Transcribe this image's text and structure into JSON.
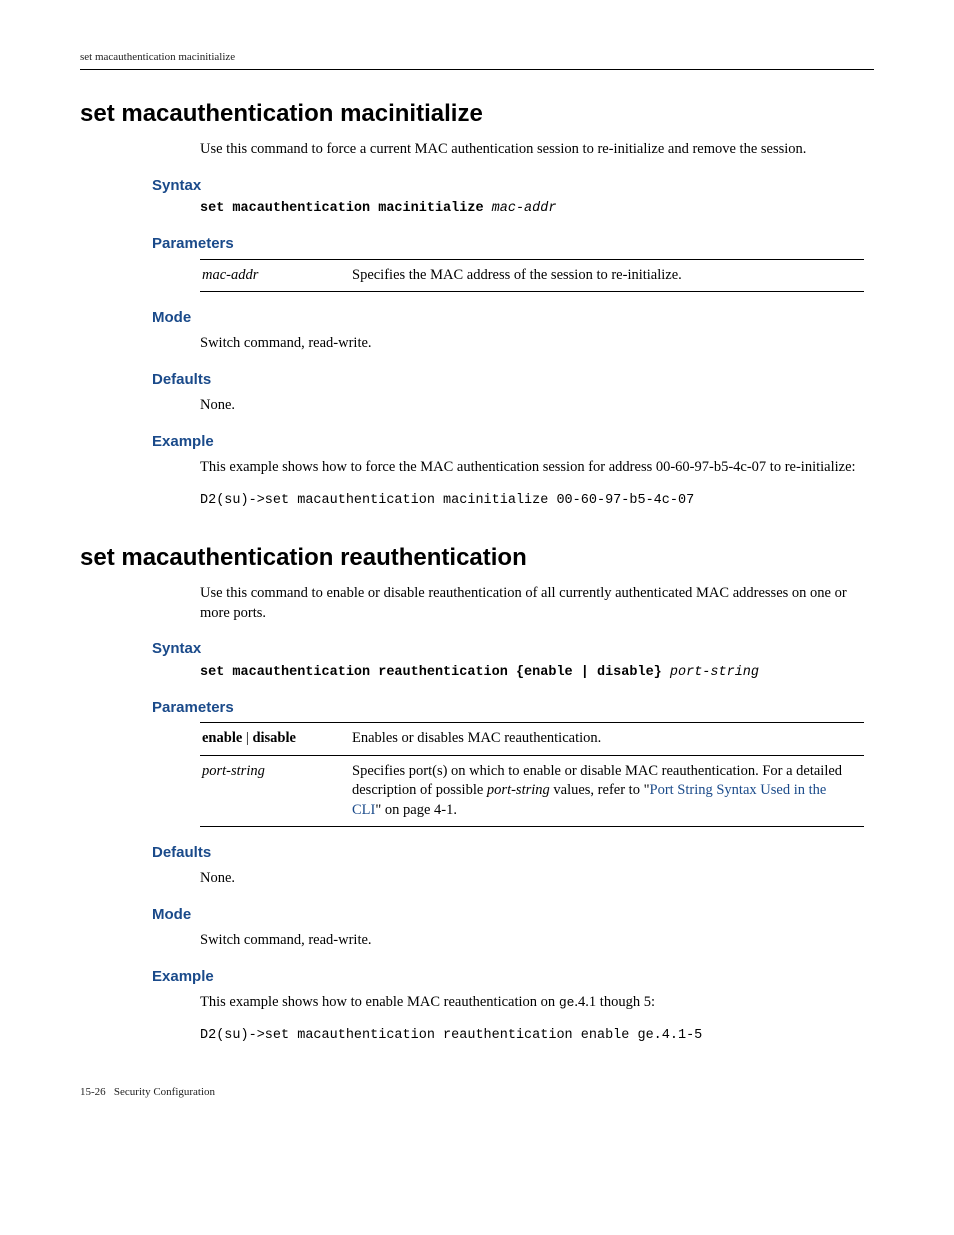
{
  "header": {
    "text": "set macauthentication macinitialize"
  },
  "section1": {
    "title": "set macauthentication macinitialize",
    "intro": "Use this command to force a current MAC authentication session to re-initialize and remove the session.",
    "syntax_label": "Syntax",
    "syntax_cmd": "set macauthentication macinitialize",
    "syntax_arg": "mac-addr",
    "parameters_label": "Parameters",
    "param_name": "mac-addr",
    "param_desc": "Specifies the MAC address of the session to re-initialize.",
    "mode_label": "Mode",
    "mode_text": "Switch command, read-write.",
    "defaults_label": "Defaults",
    "defaults_text": "None.",
    "example_label": "Example",
    "example_intro": "This example shows how to force the MAC authentication session for address 00-60-97-b5-4c-07 to re-initialize:",
    "example_code": "D2(su)->set macauthentication macinitialize 00-60-97-b5-4c-07"
  },
  "section2": {
    "title": "set macauthentication reauthentication",
    "intro": "Use this command to enable or disable reauthentication of all currently authenticated MAC addresses on one or more ports.",
    "syntax_label": "Syntax",
    "syntax_cmd": "set macauthentication reauthentication {enable | disable}",
    "syntax_arg": "port-string",
    "parameters_label": "Parameters",
    "row1_left_a": "enable",
    "row1_left_sep": " | ",
    "row1_left_b": "disable",
    "row1_desc": "Enables or disables MAC reauthentication.",
    "row2_left": "port-string",
    "row2_desc_a": "Specifies port(s) on which to enable or disable MAC reauthentication. For a detailed description of possible ",
    "row2_desc_ital": "port-string",
    "row2_desc_b": " values, refer to \"",
    "row2_link": "Port String Syntax Used in the CLI",
    "row2_desc_c": "\" on page 4-1.",
    "defaults_label": "Defaults",
    "defaults_text": "None.",
    "mode_label": "Mode",
    "mode_text": "Switch command, read-write.",
    "example_label": "Example",
    "example_intro_a": "This example shows how to enable MAC reauthentication on ",
    "example_intro_mono": "ge",
    "example_intro_b": ".4.1 though 5:",
    "example_code": "D2(su)->set macauthentication reauthentication enable ge.4.1-5"
  },
  "footer": {
    "pagenum": "15-26",
    "chapter": "Security Configuration"
  }
}
